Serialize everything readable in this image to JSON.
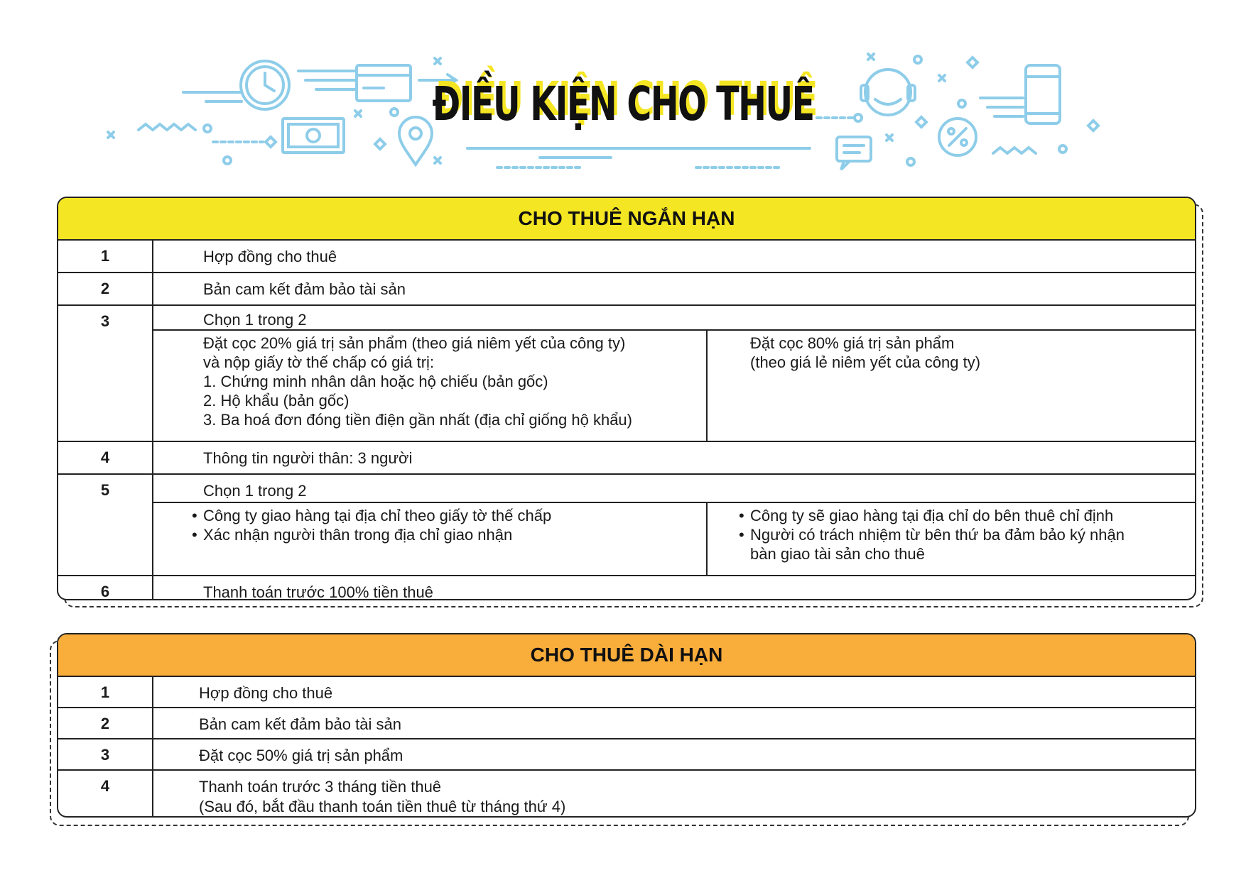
{
  "page": {
    "title": "ĐIỀU KIỆN CHO THUÊ"
  },
  "colors": {
    "short_term_header": "#f5e623",
    "long_term_header": "#f9ad3b",
    "decor": "#8ecde9"
  },
  "icons": [
    "clock-icon",
    "credit-card-icon",
    "money-bill-icon",
    "location-pin-icon",
    "headset-icon",
    "smartphone-icon",
    "percent-icon",
    "chat-icon"
  ],
  "short_term": {
    "title": "CHO THUÊ NGẮN HẠN",
    "rows": [
      {
        "num": "1",
        "text": "Hợp đồng cho thuê"
      },
      {
        "num": "2",
        "text": "Bản cam kết đảm bảo tài sản"
      },
      {
        "num": "3",
        "text": "Chọn 1 trong 2",
        "left": [
          "Đặt cọc 20% giá trị sản phẩm (theo giá niêm yết của công ty)",
          "và nộp giấy tờ thế chấp có giá trị:",
          "1. Chứng minh nhân dân hoặc hộ chiếu (bản gốc)",
          "2. Hộ khẩu (bản gốc)",
          "3. Ba hoá đơn đóng tiền điện gần nhất (địa chỉ giống hộ khẩu)"
        ],
        "right": [
          "Đặt cọc 80% giá trị sản phẩm",
          "(theo giá lẻ niêm yết của công ty)"
        ]
      },
      {
        "num": "4",
        "text": "Thông tin người thân: 3 người"
      },
      {
        "num": "5",
        "text": "Chọn 1 trong 2",
        "left": [
          "Công ty giao hàng tại địa chỉ theo giấy tờ thế chấp",
          "Xác nhận người thân trong địa chỉ giao nhận"
        ],
        "right": [
          "Công ty sẽ giao hàng tại địa chỉ do bên thuê chỉ định",
          "Người có trách nhiệm từ bên thứ ba đảm bảo ký nhận",
          "bàn giao tài sản cho thuê"
        ]
      },
      {
        "num": "6",
        "text": "Thanh toán trước 100% tiền thuê"
      }
    ]
  },
  "long_term": {
    "title": "CHO THUÊ DÀI HẠN",
    "rows": [
      {
        "num": "1",
        "text": "Hợp đồng cho thuê"
      },
      {
        "num": "2",
        "text": "Bản cam kết đảm bảo tài sản"
      },
      {
        "num": "3",
        "text": "Đặt cọc 50% giá trị sản phẩm"
      },
      {
        "num": "4",
        "text": "Thanh toán trước 3 tháng tiền thuê",
        "note": "(Sau đó, bắt đầu thanh toán tiền thuê từ tháng thứ 4)"
      }
    ]
  }
}
